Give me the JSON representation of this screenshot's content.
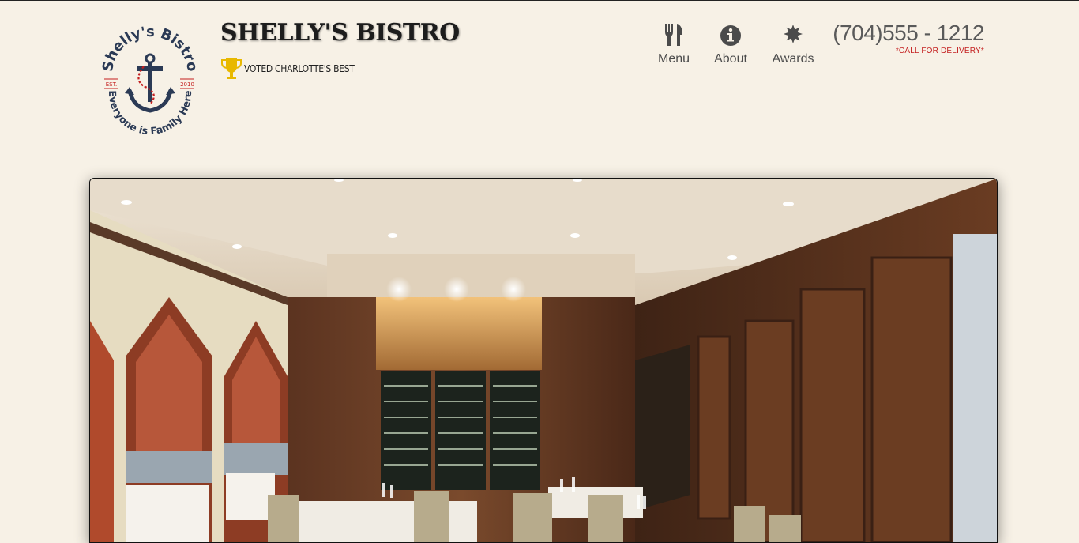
{
  "brand": {
    "title": "SHELLY'S BISTRO",
    "tagline": "VOTED CHARLOTTE'S BEST",
    "logo": {
      "name": "Shelly's Bistro",
      "est_label": "EST.",
      "year": "2010",
      "motto": "Everyone is Family Here"
    }
  },
  "nav": {
    "items": [
      {
        "label": "Menu",
        "icon": "fork-knife-icon"
      },
      {
        "label": "About",
        "icon": "info-icon"
      },
      {
        "label": "Awards",
        "icon": "starburst-icon"
      }
    ]
  },
  "contact": {
    "phone": "(704)555 - 1212",
    "note": "*CALL FOR DELIVERY*"
  },
  "hero": {
    "alt": "restaurant-dining-room-photo"
  },
  "colors": {
    "background": "#f7f1e6",
    "accent_red": "#c41f1f",
    "trophy_gold": "#e8b800",
    "anchor_navy": "#2b3a55"
  }
}
